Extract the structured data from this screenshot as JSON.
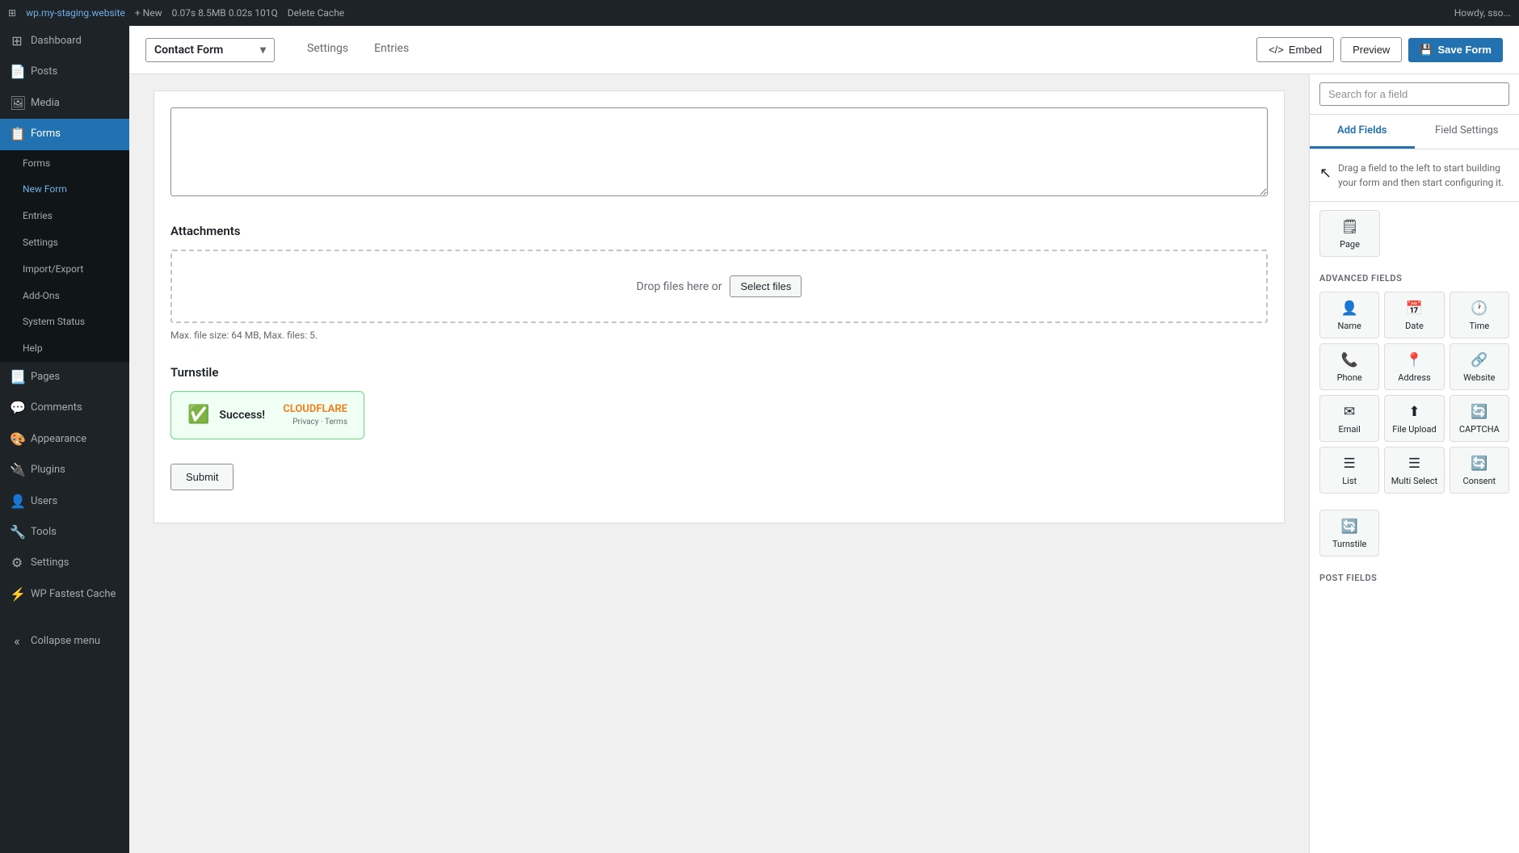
{
  "adminBar": {
    "siteName": "wp.my-staging.website",
    "links": [
      "+ New",
      "0.07s",
      "8.5MB",
      "0.02s",
      "101Q",
      "Delete Cache"
    ],
    "userLabel": "Howdy, sso..."
  },
  "sidebar": {
    "items": [
      {
        "id": "dashboard",
        "label": "Dashboard",
        "icon": "⊞"
      },
      {
        "id": "posts",
        "label": "Posts",
        "icon": "📄"
      },
      {
        "id": "media",
        "label": "Media",
        "icon": "🖼"
      },
      {
        "id": "forms",
        "label": "Forms",
        "icon": "📋",
        "active": true
      },
      {
        "id": "pages",
        "label": "Pages",
        "icon": "📃"
      },
      {
        "id": "comments",
        "label": "Comments",
        "icon": "💬"
      },
      {
        "id": "appearance",
        "label": "Appearance",
        "icon": "🎨"
      },
      {
        "id": "plugins",
        "label": "Plugins",
        "icon": "🔌"
      },
      {
        "id": "users",
        "label": "Users",
        "icon": "👤"
      },
      {
        "id": "tools",
        "label": "Tools",
        "icon": "🔧"
      },
      {
        "id": "settings",
        "label": "Settings",
        "icon": "⚙"
      },
      {
        "id": "wp-fastest-cache",
        "label": "WP Fastest Cache",
        "icon": "⚡"
      }
    ],
    "submenu": {
      "parentId": "forms",
      "items": [
        {
          "id": "forms-list",
          "label": "Forms"
        },
        {
          "id": "new-form",
          "label": "New Form",
          "active": true
        },
        {
          "id": "entries",
          "label": "Entries"
        },
        {
          "id": "settings-forms",
          "label": "Settings"
        },
        {
          "id": "import-export",
          "label": "Import/Export"
        },
        {
          "id": "add-ons",
          "label": "Add-Ons"
        },
        {
          "id": "system-status",
          "label": "System Status"
        },
        {
          "id": "help",
          "label": "Help"
        }
      ]
    },
    "collapseLabel": "Collapse menu"
  },
  "formHeader": {
    "title": "Contact Form",
    "nav": [
      {
        "id": "settings",
        "label": "Settings"
      },
      {
        "id": "entries",
        "label": "Entries"
      }
    ],
    "embedLabel": "Embed",
    "previewLabel": "Preview",
    "saveLabel": "Save Form"
  },
  "formCanvas": {
    "textareaPlaceholder": "",
    "attachmentsHeading": "Attachments",
    "dropFilesText": "Drop files here or",
    "selectFilesLabel": "Select files",
    "fileHintText": "Max. file size: 64 MB, Max. files: 5.",
    "turnstileHeading": "Turnstile",
    "successText": "Success!",
    "cloudflareName": "CLOUDFLARE",
    "cloudflareNote": "Privacy · Terms",
    "submitLabel": "Submit"
  },
  "rightPanel": {
    "tabs": [
      {
        "id": "add-fields",
        "label": "Add Fields",
        "active": true
      },
      {
        "id": "field-settings",
        "label": "Field Settings"
      }
    ],
    "searchPlaceholder": "Search for a field",
    "dragHint": "Drag a field to the left to start building your form and then start configuring it.",
    "standardFields": {
      "title": "",
      "items": [
        {
          "id": "page",
          "label": "Page",
          "icon": "🗒"
        }
      ]
    },
    "advancedFields": {
      "title": "Advanced Fields",
      "items": [
        {
          "id": "name",
          "label": "Name",
          "icon": "👤"
        },
        {
          "id": "date",
          "label": "Date",
          "icon": "📅"
        },
        {
          "id": "time",
          "label": "Time",
          "icon": "🕐"
        },
        {
          "id": "phone",
          "label": "Phone",
          "icon": "📞"
        },
        {
          "id": "address",
          "label": "Address",
          "icon": "📍"
        },
        {
          "id": "website",
          "label": "Website",
          "icon": "🔗"
        },
        {
          "id": "email",
          "label": "Email",
          "icon": "✉"
        },
        {
          "id": "file-upload",
          "label": "File Upload",
          "icon": "⬆"
        },
        {
          "id": "captcha",
          "label": "CAPTCHA",
          "icon": "🔄"
        },
        {
          "id": "list",
          "label": "List",
          "icon": "☰"
        },
        {
          "id": "multi-select",
          "label": "Multi Select",
          "icon": "☰"
        },
        {
          "id": "consent",
          "label": "Consent",
          "icon": "🔄"
        }
      ]
    },
    "postFields": {
      "title": "Post Fields"
    },
    "specialFields": {
      "items": [
        {
          "id": "turnstile",
          "label": "Turnstile",
          "icon": "🔄"
        }
      ]
    }
  }
}
